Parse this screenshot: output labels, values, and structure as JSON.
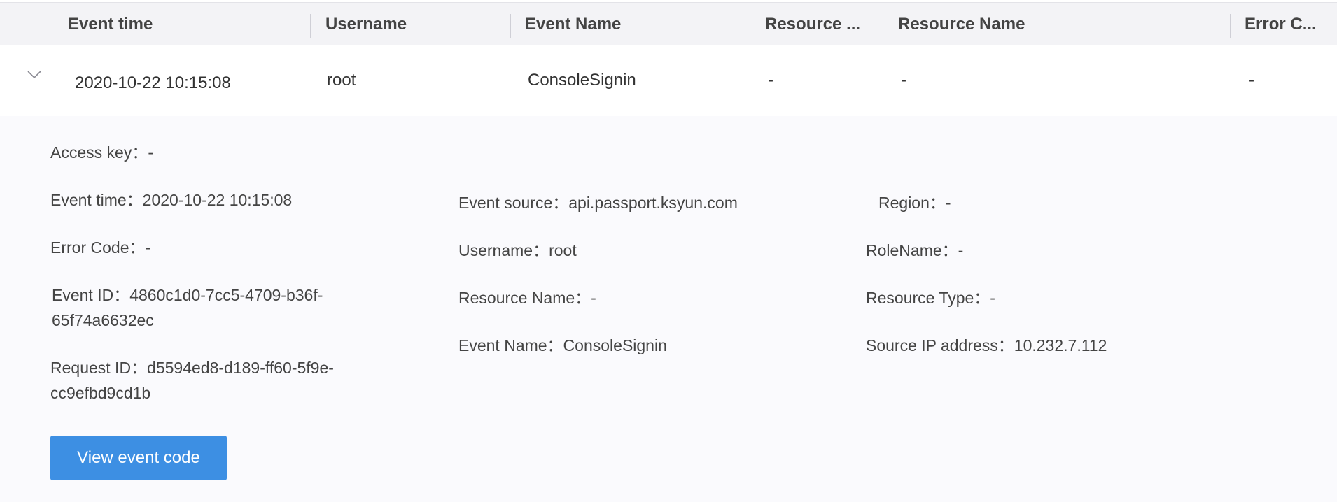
{
  "table": {
    "columns": [
      "Event time",
      "Username",
      "Event Name",
      "Resource ...",
      "Resource Name",
      "Error C..."
    ],
    "row": {
      "event_time": "2020-10-22 10:15:08",
      "username": "root",
      "event_name": "ConsoleSignin",
      "resource_type": "-",
      "resource_name": "-",
      "error_code": "-"
    }
  },
  "detail": {
    "access_key": "Access key：-",
    "event_time": "Event time：2020-10-22 10:15:08",
    "error_code": "Error Code：-",
    "event_id": "Event ID：4860c1d0-7cc5-4709-b36f-65f74a6632ec",
    "request_id": "Request ID：d5594ed8-d189-ff60-5f9e-cc9efbd9cd1b",
    "event_source": "Event source：api.passport.ksyun.com",
    "username": "Username：root",
    "resource_name": "Resource Name：-",
    "event_name": "Event Name：ConsoleSignin",
    "region": "Region：-",
    "role_name": "RoleName：-",
    "resource_type": "Resource Type：-",
    "source_ip": "Source IP address：10.232.7.112",
    "view_code_button": "View event code"
  },
  "icons": {
    "expand": "chevron-down-icon"
  },
  "colors": {
    "header_bg": "#f3f3f6",
    "detail_bg": "#fafafd",
    "button_bg": "#3d8fe3"
  }
}
